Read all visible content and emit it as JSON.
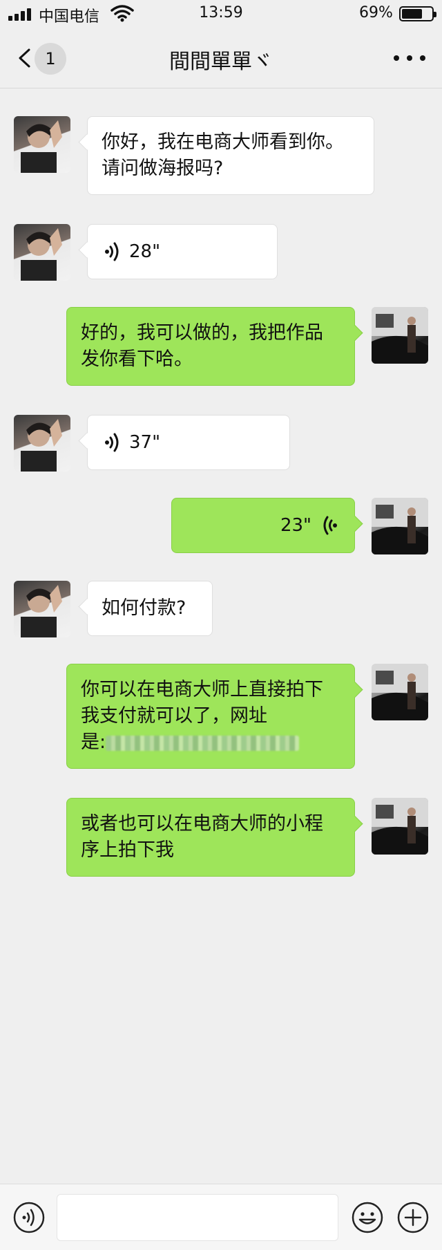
{
  "status_bar": {
    "carrier": "中国电信",
    "time": "13:59",
    "battery_percent": "69%",
    "battery_level": 0.69
  },
  "nav": {
    "unread_count": "1",
    "title": "間間單單ヾ",
    "back_icon": "chevron-left-icon",
    "more_icon": "more-dots-icon"
  },
  "messages": [
    {
      "side": "in",
      "type": "text",
      "text": "你好，我在电商大师看到你。\n请问做海报吗?"
    },
    {
      "side": "in",
      "type": "voice",
      "duration": "28\""
    },
    {
      "side": "out",
      "type": "text",
      "text": "好的，我可以做的，我把作品\n发你看下哈。"
    },
    {
      "side": "in",
      "type": "voice",
      "duration": "37\""
    },
    {
      "side": "out",
      "type": "voice",
      "duration": "23\""
    },
    {
      "side": "in",
      "type": "text",
      "text": "如何付款?"
    },
    {
      "side": "out",
      "type": "text",
      "text_line1": "你可以在电商大师上直接拍下",
      "text_line2": "我支付就可以了，网址",
      "text_line3": "是:"
    },
    {
      "side": "out",
      "type": "text",
      "text": "或者也可以在电商大师的小程\n序上拍下我"
    }
  ],
  "input_bar": {
    "placeholder": "",
    "voice_icon": "voice-input-icon",
    "emoji_icon": "emoji-icon",
    "plus_icon": "plus-icon"
  },
  "colors": {
    "background": "#efefef",
    "outgoing_bubble": "#9ee55a",
    "incoming_bubble": "#ffffff"
  }
}
